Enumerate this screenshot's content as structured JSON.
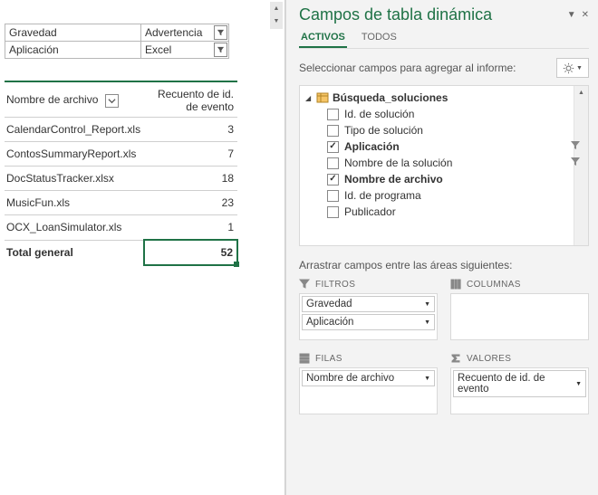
{
  "filters_slicer": [
    {
      "label": "Gravedad",
      "value": "Advertencia"
    },
    {
      "label": "Aplicación",
      "value": "Excel"
    }
  ],
  "pivot": {
    "row_header": "Nombre de archivo",
    "value_header": "Recuento de id. de evento",
    "rows": [
      {
        "name": "CalendarControl_Report.xls",
        "count": 3
      },
      {
        "name": "ContosSummaryReport.xls",
        "count": 7
      },
      {
        "name": "DocStatusTracker.xlsx",
        "count": 18
      },
      {
        "name": "MusicFun.xls",
        "count": 23
      },
      {
        "name": "OCX_LoanSimulator.xls",
        "count": 1
      }
    ],
    "total_label": "Total general",
    "total_value": 52
  },
  "pane_title": "Campos de tabla dinámica",
  "tabs": {
    "active": "ACTIVOS",
    "other": "TODOS"
  },
  "select_caption": "Seleccionar campos para agregar al informe:",
  "fields_table_name": "Búsqueda_soluciones",
  "fields": [
    {
      "label": "Id. de solución",
      "checked": false,
      "filter": false
    },
    {
      "label": "Tipo de solución",
      "checked": false,
      "filter": false
    },
    {
      "label": "Aplicación",
      "checked": true,
      "filter": true,
      "bold": true
    },
    {
      "label": "Nombre de la solución",
      "checked": false,
      "filter": true
    },
    {
      "label": "Nombre de archivo",
      "checked": true,
      "filter": false,
      "bold": true
    },
    {
      "label": "Id. de programa",
      "checked": false,
      "filter": false
    },
    {
      "label": "Publicador",
      "checked": false,
      "filter": false
    }
  ],
  "areas_caption": "Arrastrar campos entre las áreas siguientes:",
  "areas": {
    "filters_label": "FILTROS",
    "columns_label": "COLUMNAS",
    "rows_label": "FILAS",
    "values_label": "VALORES",
    "filters": [
      "Gravedad",
      "Aplicación"
    ],
    "columns": [],
    "rows": [
      "Nombre de archivo"
    ],
    "values": [
      "Recuento de id. de evento"
    ]
  }
}
